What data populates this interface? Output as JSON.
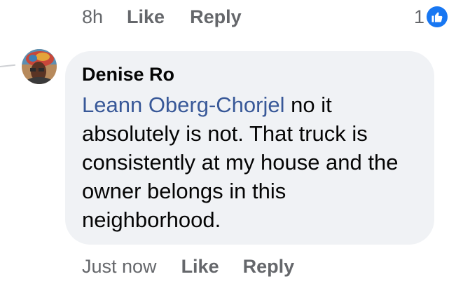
{
  "previous_comment": {
    "timestamp": "8h",
    "like_label": "Like",
    "reply_label": "Reply",
    "reaction_count": "1",
    "reaction_icon": "thumbs-up-icon",
    "reaction_color": "#1877f2"
  },
  "comment": {
    "author": "Denise Ro",
    "mention": "Leann Oberg-Chorjel",
    "text": " no it absolutely is not. That truck is consistently at my house and the owner belongs in this neighborhood.",
    "timestamp": "Just now",
    "like_label": "Like",
    "reply_label": "Reply",
    "avatar_icon": "user-avatar"
  },
  "colors": {
    "bubble": "#f0f2f5",
    "mention": "#385898",
    "meta": "#65676b",
    "text": "#050505"
  }
}
